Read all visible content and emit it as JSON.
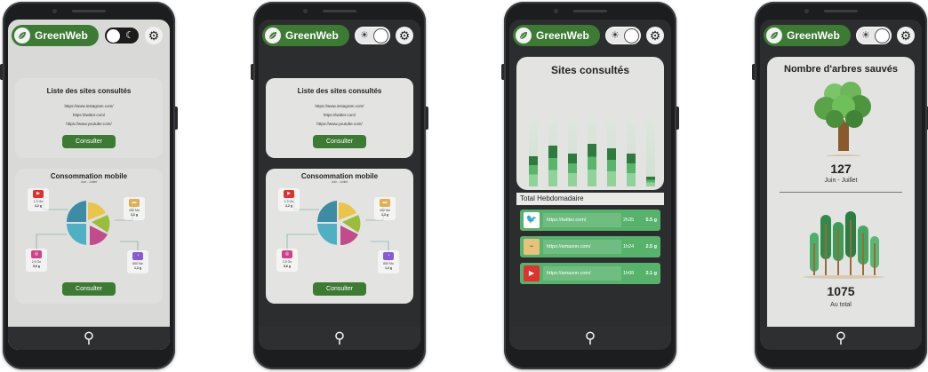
{
  "app": {
    "brand": "GreenWeb",
    "colors": {
      "brand_green": "#3d7a34",
      "row_green": "#57b26b"
    }
  },
  "screen1": {
    "theme": "light",
    "toggle_icon": "moon-icon",
    "sites_card": {
      "title": "Liste des sites consultés",
      "links": [
        "https://www.instagram.com/",
        "https://twitter.com/",
        "https://www.youtube.com/"
      ],
      "button": "Consulter"
    },
    "mobile_card": {
      "title": "Consommation mobile",
      "subtitle": "Juin - Juillet",
      "apps": [
        {
          "icon": "youtube-icon",
          "v1": "1.3 Go",
          "v2": "3,2 g"
        },
        {
          "icon": "amazon-icon",
          "v1": "402 Mo",
          "v2": "1,3 g"
        },
        {
          "icon": "instagram-icon",
          "v1": "2,5 Go",
          "v2": "5,6 g"
        },
        {
          "icon": "app-icon",
          "v1": "850 Mo",
          "v2": "1,3 g"
        }
      ],
      "button": "Consulter"
    }
  },
  "screen2": {
    "theme": "dark",
    "toggle_icon": "sun-icon",
    "sites_card": {
      "title": "Liste des sites consultés",
      "links": [
        "https://www.instagram.com/",
        "https://twitter.com/",
        "https://www.youtube.com/"
      ],
      "button": "Consulter"
    },
    "mobile_card": {
      "title": "Consommation mobile",
      "subtitle": "Juin - Juillet",
      "apps": [
        {
          "icon": "youtube-icon",
          "v1": "1.3 Go",
          "v2": "3,2 g"
        },
        {
          "icon": "amazon-icon",
          "v1": "402 Mo",
          "v2": "1,3 g"
        },
        {
          "icon": "instagram-icon",
          "v1": "2,5 Go",
          "v2": "5,6 g"
        },
        {
          "icon": "app-icon",
          "v1": "850 Mo",
          "v2": "1,3 g"
        }
      ],
      "button": "Consulter"
    }
  },
  "screen3": {
    "title": "Sites consultés",
    "days": [
      "D",
      "L",
      "M",
      "M",
      "J",
      "V",
      "S"
    ],
    "bar_levels": [
      0.42,
      0.58,
      0.46,
      0.6,
      0.54,
      0.46,
      0.14
    ],
    "total_label": "Total Hebdomadaire",
    "rows": [
      {
        "icon": "twitter-icon",
        "url": "https://twitter.com/",
        "time": "2h35",
        "size": "5.5 g"
      },
      {
        "icon": "amazon-icon",
        "url": "https://amazon.com/",
        "time": "1h24",
        "size": "2.5 g"
      },
      {
        "icon": "youtube-icon",
        "url": "https://amazon.com/",
        "time": "1h08",
        "size": "2.1 g"
      }
    ]
  },
  "screen4": {
    "title": "Nombre d'arbres sauvés",
    "count1": "127",
    "caption1": "Juin - Juillet",
    "count2": "1075",
    "caption2": "Au total"
  }
}
